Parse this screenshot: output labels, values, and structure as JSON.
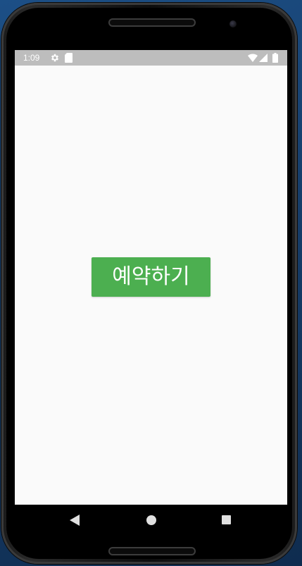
{
  "status_bar": {
    "time": "1:09",
    "icons": [
      "gear-icon",
      "sd-card-icon",
      "wifi-icon",
      "cell-signal-icon",
      "battery-icon"
    ],
    "background_color": "#bdbdbd"
  },
  "main": {
    "reserve_button_label": "예약하기",
    "button_color": "#4caf50",
    "background_color": "#fafafa"
  },
  "nav_bar": {
    "icons": [
      "back-icon",
      "home-icon",
      "recents-icon"
    ]
  }
}
